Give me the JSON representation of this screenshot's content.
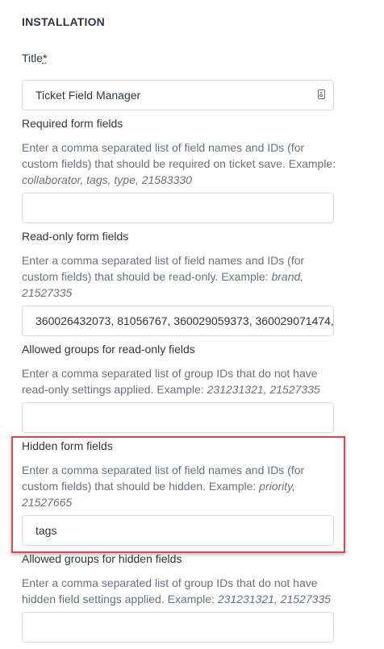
{
  "section": {
    "title": "INSTALLATION"
  },
  "title_field": {
    "label": "Title",
    "required_mark": "*",
    "value": "Ticket Field Manager",
    "icon": "contact-card-icon"
  },
  "required_fields": {
    "label": "Required form fields",
    "hint_text": "Enter a comma separated list of field names and IDs (for custom fields) that should be required on ticket save. Example: ",
    "hint_example": "collaborator, tags, type, 21583330",
    "value": ""
  },
  "readonly_fields": {
    "label": "Read-only form fields",
    "hint_text": "Enter a comma separated list of field names and IDs (for custom fields) that should be read-only. Example: ",
    "hint_example": "brand, 21527335",
    "value": "360026432073, 81056767, 360029059373, 360029071474,"
  },
  "readonly_groups": {
    "label": "Allowed groups for read-only fields",
    "hint_text": "Enter a comma separated list of group IDs that do not have read-only settings applied. Example: ",
    "hint_example": "231231321, 21527335",
    "value": ""
  },
  "hidden_fields": {
    "label": "Hidden form fields",
    "hint_text": "Enter a comma separated list of field names and IDs (for custom fields) that should be hidden. Example: ",
    "hint_example": "priority, 21527665",
    "value": "tags"
  },
  "hidden_groups": {
    "label": "Allowed groups for hidden fields",
    "hint_text": "Enter a comma separated list of group IDs that do not have hidden field settings applied. Example: ",
    "hint_example": "231231321, 21527335",
    "value": ""
  },
  "colors": {
    "highlight_border": "#e0464f",
    "text": "#2f3941",
    "hint_text": "#68737d",
    "input_border": "#d8dcde"
  }
}
